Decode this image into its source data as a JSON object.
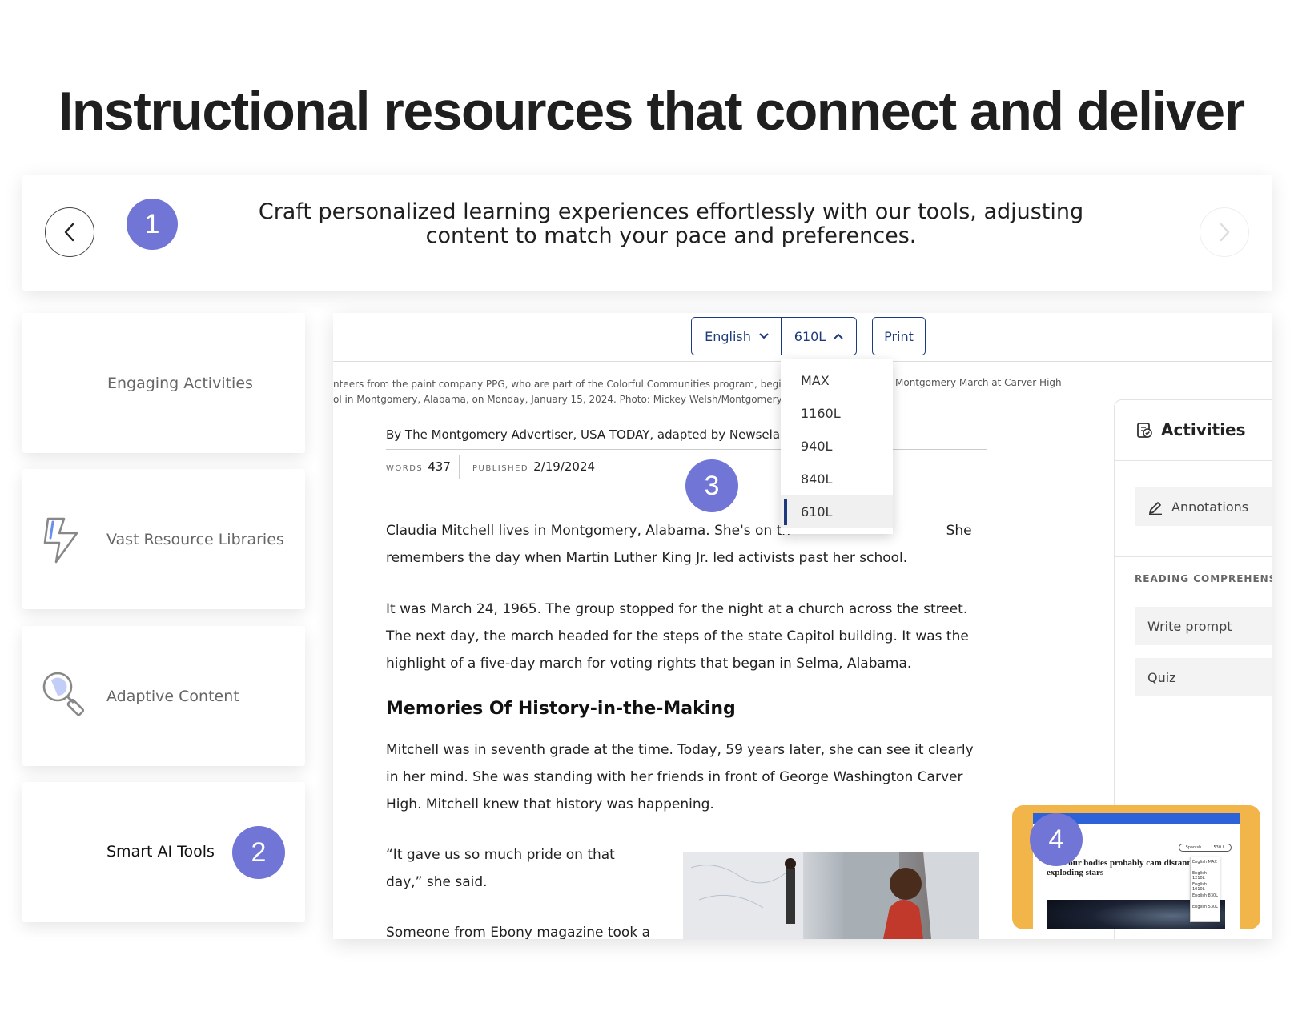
{
  "hero": {
    "title": "Instructional resources that connect and deliver"
  },
  "intro": {
    "step": "1",
    "text": "Craft personalized learning experiences effortlessly with our tools, adjusting content to match your pace and preferences."
  },
  "features": [
    {
      "label": "Engaging Activities",
      "icon": ""
    },
    {
      "label": "Vast Resource Libraries",
      "icon": "lightning-icon"
    },
    {
      "label": "Adaptive Content",
      "icon": "magnifier-icon"
    },
    {
      "label": "Smart AI Tools",
      "icon": "",
      "step": "2"
    }
  ],
  "article": {
    "toolbar": {
      "language": "English",
      "level": "610L",
      "print": "Print"
    },
    "level_options": [
      "MAX",
      "1160L",
      "940L",
      "840L",
      "610L"
    ],
    "selected_level": "610L",
    "caption_line1": "nteers from the paint company PPG, who are part of the Colorful Communities program, begin paintir",
    "caption_line2": "ol in Montgomery, Alabama, on Monday, January 15, 2024. Photo: Mickey Welsh/Montgomery Adver",
    "caption_right": "Montgomery March at Carver High",
    "byline": "By The Montgomery Advertiser, USA TODAY, adapted by Newsela",
    "words_label": "WORDS",
    "words": "437",
    "published_label": "PUBLISHED",
    "published": "2/19/2024",
    "step": "3",
    "paragraph1": "Claudia Mitchell lives in Montgomery, Alabama. She's on th                                    She remembers the day when Martin Luther King Jr. led activists past her school.",
    "paragraph2": "It was March 24, 1965. The group stopped for the night at a church across the street. The next day, the march headed for the steps of the state Capitol building. It was the highlight of a five-day march for voting rights that began in Selma, Alabama.",
    "subheading": "Memories Of History-in-the-Making",
    "paragraph3": "Mitchell was in seventh grade at the time. Today, 59 years later, she can see it clearly in her mind. She was standing with her friends in front of George Washington Carver High. Mitchell knew that history was happening.",
    "quote": "“It gave us so much pride on that day,” she said.",
    "paragraph5": "Someone from Ebony magazine took a"
  },
  "activities": {
    "title": "Activities",
    "annotations": "Annotations",
    "section": "READING COMPREHENSIO",
    "write_prompt": "Write prompt",
    "quiz": "Quiz"
  },
  "thumbnail": {
    "step": "4",
    "title": "...s in our bodies probably cam distant exploding stars",
    "select_lang": "Spanish",
    "select_level": "530 L",
    "menu": [
      "English MAX",
      "English 1210L",
      "English 1010L",
      "English 830L",
      "English 530L"
    ]
  },
  "colors": {
    "accent": "#7075d6",
    "navy": "#1d3a7a",
    "thumbnail_bg": "#f2b54a"
  }
}
